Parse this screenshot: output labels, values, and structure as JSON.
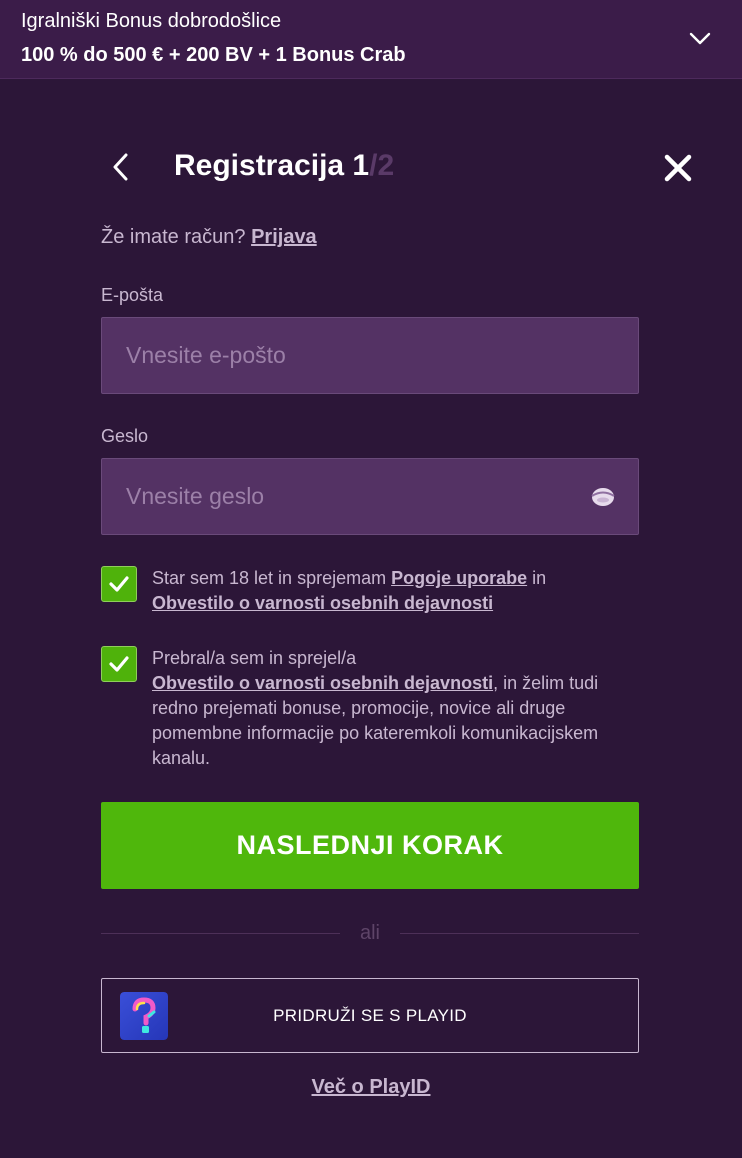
{
  "banner": {
    "title": "Igralniški Bonus dobrodošlice",
    "offer": "100 % do 500 € + 200 BV + 1 Bonus Crab"
  },
  "header": {
    "title_main": "Registracija 1",
    "title_rest": "/2"
  },
  "login_prompt": {
    "text": "Že imate račun? ",
    "link": "Prijava"
  },
  "email": {
    "label": "E-pošta",
    "placeholder": "Vnesite e-pošto",
    "value": ""
  },
  "password": {
    "label": "Geslo",
    "placeholder": "Vnesite geslo",
    "value": ""
  },
  "consents": [
    {
      "checked": true,
      "text_1": "Star sem 18 let in sprejemam ",
      "link_1": "Pogoje uporabe",
      "text_2": " in ",
      "link_2": "Obvestilo o varnosti osebnih dejavnosti"
    },
    {
      "checked": true,
      "text_1": "Prebral/a sem in sprejel/a ",
      "link_1": "Obvestilo o varnosti osebnih dejavnosti",
      "text_2": ", in želim tudi redno prejemati bonuse, promocije, novice ali druge pomembne informacije po kateremkoli komunikacijskem kanalu."
    }
  ],
  "next_button": "NASLEDNJI KORAK",
  "divider": "ali",
  "playid": {
    "label": "PRIDRUŽI SE S PLAYID",
    "more_link": "Več o PlayID"
  },
  "colors": {
    "background": "#2c1638",
    "banner": "#3b1c49",
    "accent_green": "#4fb70c",
    "input_bg": "#543264",
    "muted_text": "#c8b7d0"
  },
  "icons": [
    "chevron-down-icon",
    "chevron-left-icon",
    "close-icon",
    "eye-icon",
    "checkmark-icon",
    "playid-logo-icon"
  ]
}
